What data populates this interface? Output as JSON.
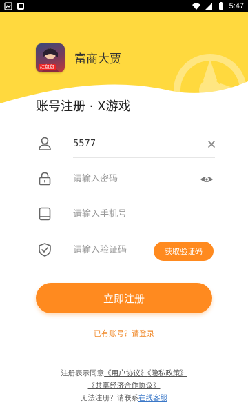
{
  "status_bar": {
    "time": "5:47",
    "icons": [
      "notification-icon",
      "app-icon-small",
      "wifi-icon",
      "signal-icon",
      "battery-icon"
    ]
  },
  "header": {
    "app_name": "富商大贾",
    "app_badge": "红包包",
    "page_title": "账号注册 · X游戏",
    "accent": "#FFD93E"
  },
  "form": {
    "username": {
      "value": "5577",
      "placeholder": ""
    },
    "password": {
      "value": "",
      "placeholder": "请输入密码"
    },
    "phone": {
      "value": "",
      "placeholder": "请输入手机号"
    },
    "code": {
      "value": "",
      "placeholder": "请输入验证码"
    },
    "get_code_label": "获取验证码"
  },
  "actions": {
    "register_label": "立即注册",
    "login_link": "已有账号？请登录",
    "button_color": "#FF8A1F"
  },
  "footer": {
    "agree_prefix": "注册表示同意",
    "user_agreement": "《用户协议》",
    "privacy_policy": "《隐私政策》",
    "shared_economy": "《共享经济合作协议》",
    "help_prefix": "无法注册？请联系",
    "online_service": "在线客服"
  }
}
